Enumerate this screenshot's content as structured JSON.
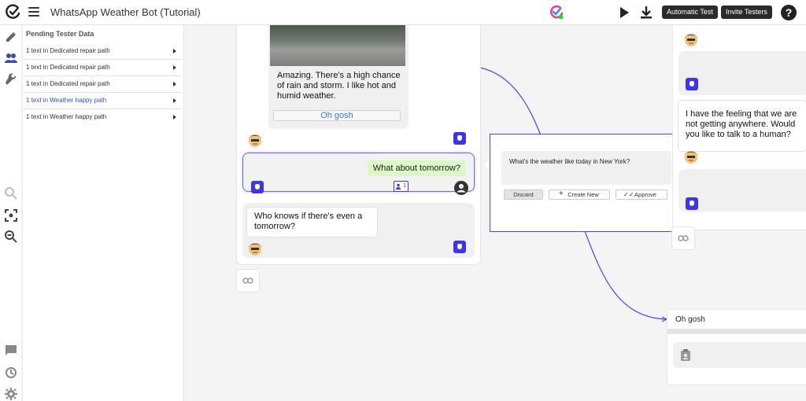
{
  "header": {
    "title": "WhatsApp Weather Bot (Tutorial)",
    "automatic_test_label": "Automatic Test",
    "invite_testers_label": "Invite Testers",
    "help_label": "?"
  },
  "pending_panel": {
    "heading": "Pending Tester Data",
    "rows": [
      {
        "label": "1 text in Dedicated repair path"
      },
      {
        "label": "1 text in Dedicated repair path"
      },
      {
        "label": "1 text in Dedicated repair path"
      },
      {
        "label": "1 text in Weather happy path"
      },
      {
        "label": "1 text in Weather happy path"
      }
    ]
  },
  "canvas": {
    "bot_message_1": "Amazing. There's a high chance of rain and storm. I like hot and humid weather.",
    "quick_reply_label": "Oh gosh",
    "user_message": "What about tomorrow?",
    "tester_count": "1",
    "bot_message_2": "Who knows if there's even a tomorrow?",
    "popup_question": "What's the weather like today in New York?",
    "discard_label": "Discard",
    "create_new_label": "Create New",
    "approve_label": "Approve",
    "right_message": "I have the feeling that we are not getting anywhere. Would you like to talk to a human?",
    "oh_gosh_node_label": "Oh gosh"
  },
  "colors": {
    "accent": "#3d35e6",
    "user_bubble": "#dcf8c6",
    "link_blue": "#2f7de1"
  }
}
